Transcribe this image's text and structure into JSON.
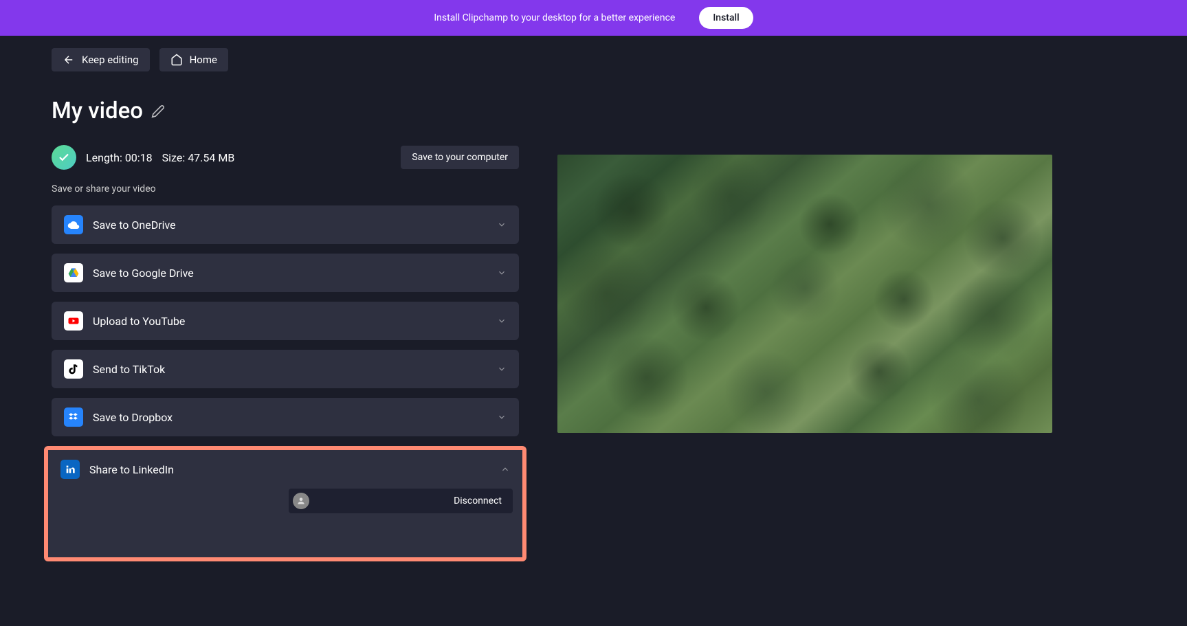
{
  "banner": {
    "text": "Install Clipchamp to your desktop for a better experience",
    "button": "Install"
  },
  "nav": {
    "keep_editing": "Keep editing",
    "home": "Home"
  },
  "title": "My video",
  "status": {
    "length_label": "Length:",
    "length_value": "00:18",
    "size_label": "Size:",
    "size_value": "47.54 MB"
  },
  "save_computer": "Save to your computer",
  "share_label": "Save or share your video",
  "share_options": {
    "onedrive": "Save to OneDrive",
    "gdrive": "Save to Google Drive",
    "youtube": "Upload to YouTube",
    "tiktok": "Send to TikTok",
    "dropbox": "Save to Dropbox",
    "linkedin": "Share to LinkedIn"
  },
  "linkedin_panel": {
    "disconnect": "Disconnect"
  }
}
